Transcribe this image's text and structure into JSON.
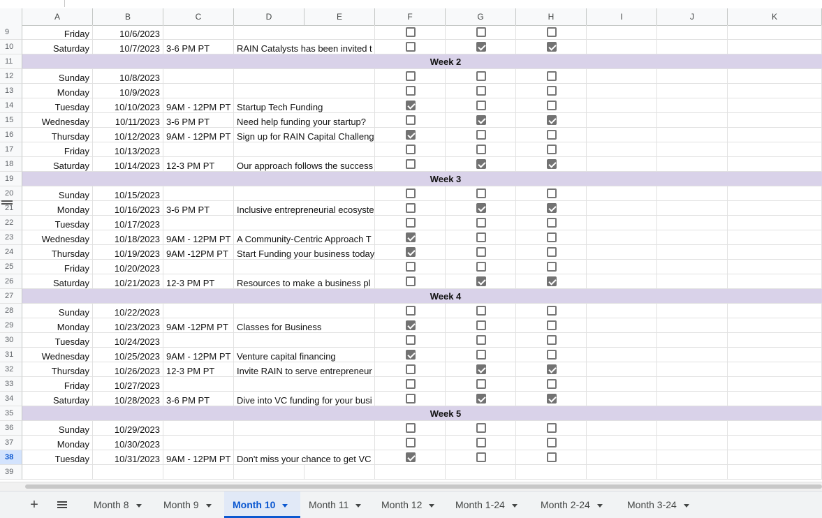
{
  "columns": [
    "A",
    "B",
    "C",
    "D",
    "E",
    "F",
    "G",
    "H",
    "I",
    "J",
    "K"
  ],
  "selected_row": 38,
  "rows": [
    {
      "num": 9,
      "type": "data",
      "day": "Friday",
      "date": "10/6/2023",
      "time": "",
      "desc": "",
      "f": false,
      "g": false,
      "h": false
    },
    {
      "num": 10,
      "type": "data",
      "day": "Saturday",
      "date": "10/7/2023",
      "time": "3-6 PM PT",
      "desc": "RAIN Catalysts has been invited t",
      "f": false,
      "g": true,
      "h": true
    },
    {
      "num": 11,
      "type": "week",
      "label": "Week 2"
    },
    {
      "num": 12,
      "type": "data",
      "day": "Sunday",
      "date": "10/8/2023",
      "time": "",
      "desc": "",
      "f": false,
      "g": false,
      "h": false
    },
    {
      "num": 13,
      "type": "data",
      "day": "Monday",
      "date": "10/9/2023",
      "time": "",
      "desc": "",
      "f": false,
      "g": false,
      "h": false
    },
    {
      "num": 14,
      "type": "data",
      "day": "Tuesday",
      "date": "10/10/2023",
      "time": "9AM - 12PM PT",
      "desc": "Startup Tech Funding",
      "f": true,
      "g": false,
      "h": false
    },
    {
      "num": 15,
      "type": "data",
      "day": "Wednesday",
      "date": "10/11/2023",
      "time": "3-6 PM PT",
      "desc": "Need help funding your startup?",
      "f": false,
      "g": true,
      "h": true
    },
    {
      "num": 16,
      "type": "data",
      "day": "Thursday",
      "date": "10/12/2023",
      "time": "9AM - 12PM PT",
      "desc": "Sign up for RAIN Capital Challeng",
      "f": true,
      "g": false,
      "h": false
    },
    {
      "num": 17,
      "type": "data",
      "day": "Friday",
      "date": "10/13/2023",
      "time": "",
      "desc": "",
      "f": false,
      "g": false,
      "h": false
    },
    {
      "num": 18,
      "type": "data",
      "day": "Saturday",
      "date": "10/14/2023",
      "time": "12-3 PM PT",
      "desc": "Our approach follows the success",
      "f": false,
      "g": true,
      "h": true
    },
    {
      "num": 19,
      "type": "week",
      "label": "Week 3"
    },
    {
      "num": 20,
      "type": "data",
      "day": "Sunday",
      "date": "10/15/2023",
      "time": "",
      "desc": "",
      "f": false,
      "g": false,
      "h": false
    },
    {
      "num": 21,
      "type": "data",
      "day": "Monday",
      "date": "10/16/2023",
      "time": "3-6 PM PT",
      "desc": "Inclusive entrepreneurial ecosyste",
      "f": false,
      "g": true,
      "h": true
    },
    {
      "num": 22,
      "type": "data",
      "day": "Tuesday",
      "date": "10/17/2023",
      "time": "",
      "desc": "",
      "f": false,
      "g": false,
      "h": false
    },
    {
      "num": 23,
      "type": "data",
      "day": "Wednesday",
      "date": "10/18/2023",
      "time": "9AM - 12PM PT",
      "desc": "A Community-Centric Approach T",
      "f": true,
      "g": false,
      "h": false
    },
    {
      "num": 24,
      "type": "data",
      "day": "Thursday",
      "date": "10/19/2023",
      "time": "9AM -12PM PT",
      "desc": "Start Funding your business today",
      "f": true,
      "g": false,
      "h": false
    },
    {
      "num": 25,
      "type": "data",
      "day": "Friday",
      "date": "10/20/2023",
      "time": "",
      "desc": "",
      "f": false,
      "g": false,
      "h": false
    },
    {
      "num": 26,
      "type": "data",
      "day": "Saturday",
      "date": "10/21/2023",
      "time": "12-3 PM PT",
      "desc": "Resources to make a business pl",
      "f": false,
      "g": true,
      "h": true
    },
    {
      "num": 27,
      "type": "week",
      "label": "Week 4"
    },
    {
      "num": 28,
      "type": "data",
      "day": "Sunday",
      "date": "10/22/2023",
      "time": "",
      "desc": "",
      "f": false,
      "g": false,
      "h": false
    },
    {
      "num": 29,
      "type": "data",
      "day": "Monday",
      "date": "10/23/2023",
      "time": "9AM -12PM PT",
      "desc": "Classes for Business",
      "f": true,
      "g": false,
      "h": false
    },
    {
      "num": 30,
      "type": "data",
      "day": "Tuesday",
      "date": "10/24/2023",
      "time": "",
      "desc": "",
      "f": false,
      "g": false,
      "h": false
    },
    {
      "num": 31,
      "type": "data",
      "day": "Wednesday",
      "date": "10/25/2023",
      "time": "9AM - 12PM PT",
      "desc": "Venture capital financing",
      "f": true,
      "g": false,
      "h": false
    },
    {
      "num": 32,
      "type": "data",
      "day": "Thursday",
      "date": "10/26/2023",
      "time": "12-3 PM PT",
      "desc": "Invite RAIN to serve entrepreneur",
      "f": false,
      "g": true,
      "h": true
    },
    {
      "num": 33,
      "type": "data",
      "day": "Friday",
      "date": "10/27/2023",
      "time": "",
      "desc": "",
      "f": false,
      "g": false,
      "h": false
    },
    {
      "num": 34,
      "type": "data",
      "day": "Saturday",
      "date": "10/28/2023",
      "time": "3-6 PM PT",
      "desc": "Dive into VC funding for your busi",
      "f": false,
      "g": true,
      "h": true
    },
    {
      "num": 35,
      "type": "week",
      "label": "Week 5"
    },
    {
      "num": 36,
      "type": "data",
      "day": "Sunday",
      "date": "10/29/2023",
      "time": "",
      "desc": "",
      "f": false,
      "g": false,
      "h": false
    },
    {
      "num": 37,
      "type": "data",
      "day": "Monday",
      "date": "10/30/2023",
      "time": "",
      "desc": "",
      "f": false,
      "g": false,
      "h": false
    },
    {
      "num": 38,
      "type": "data",
      "day": "Tuesday",
      "date": "10/31/2023",
      "time": "9AM - 12PM PT",
      "desc": "Don't miss your chance to get VC",
      "f": true,
      "g": false,
      "h": false
    },
    {
      "num": 39,
      "type": "empty"
    }
  ],
  "sheet_tabs": [
    {
      "label": "Month 8",
      "active": false
    },
    {
      "label": "Month 9",
      "active": false
    },
    {
      "label": "Month 10",
      "active": true
    },
    {
      "label": "Month 11",
      "active": false
    },
    {
      "label": "Month 12",
      "active": false
    },
    {
      "label": "Month 1-24",
      "active": false
    },
    {
      "label": "Month 2-24",
      "active": false
    },
    {
      "label": "Month 3-24",
      "active": false
    }
  ],
  "tab_icons": {
    "add": "plus-icon",
    "all": "menu-icon"
  }
}
